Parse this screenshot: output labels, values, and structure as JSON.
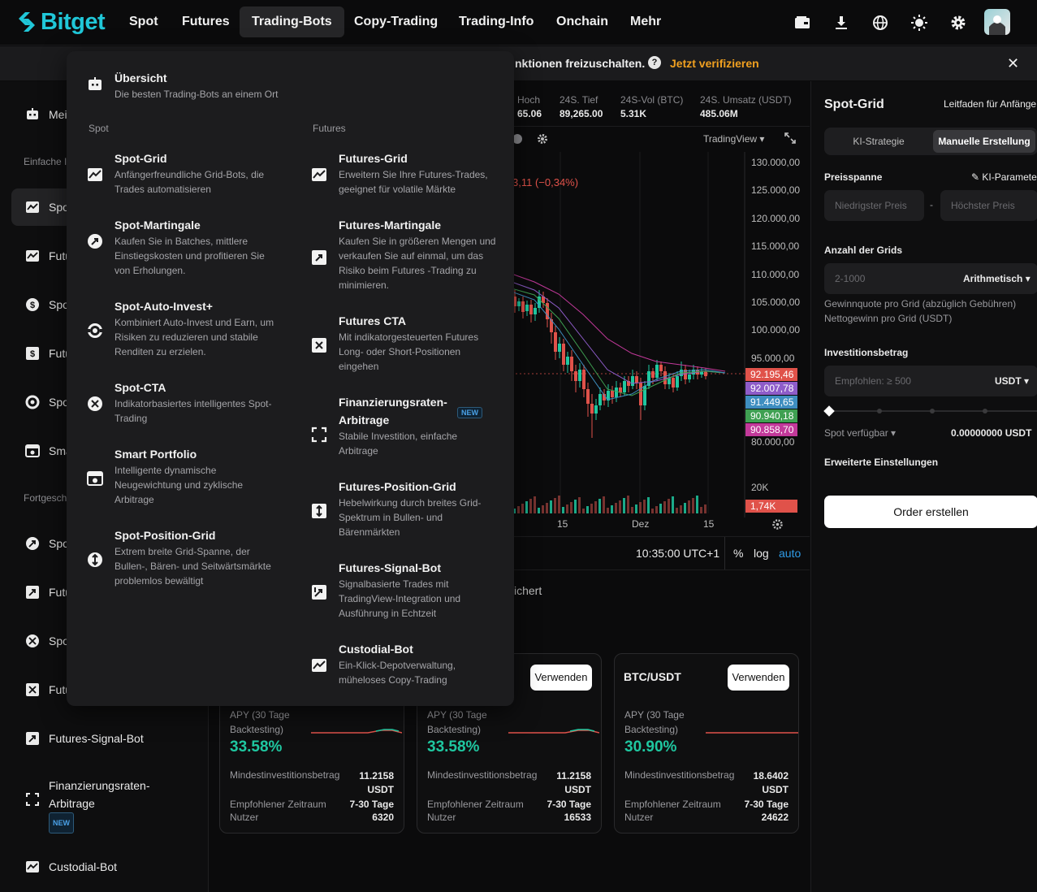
{
  "nav": {
    "logo": "Bitget",
    "items": [
      "Spot",
      "Futures",
      "Trading-Bots",
      "Copy-Trading",
      "Trading-Info",
      "Onchain",
      "Mehr"
    ]
  },
  "verify": {
    "text": "nktionen freizuschalten.",
    "link": "Jetzt verifizieren",
    "close": "✕"
  },
  "sidebar": {
    "items": [
      {
        "label": "Mei"
      },
      {
        "label": "Spo"
      },
      {
        "label": "Futu"
      },
      {
        "label": "Spo"
      },
      {
        "label": "Futu"
      },
      {
        "label": "Spo"
      },
      {
        "label": "Sma"
      },
      {
        "label": "Spo"
      },
      {
        "label": "Futu"
      },
      {
        "label": "Spo"
      },
      {
        "label": "Futu"
      },
      {
        "label": "Futures-Signal-Bot"
      },
      {
        "label": "Finanzierungsraten-"
      },
      {
        "label": "Arbitrage"
      },
      {
        "label": "Custodial-Bot"
      }
    ],
    "section_basic": "Einfache I",
    "section_advanced": "Fortgesch",
    "new_badge": "NEW"
  },
  "stats": {
    "high_label": "Hoch",
    "high_value": "65.06",
    "low_label": "24S. Tief",
    "low_value": "89,265.00",
    "vol_label": "24S-Vol (BTC)",
    "vol_value": "5.31K",
    "turnover_label": "24S. Umsatz (USDT)",
    "turnover_value": "485.06M"
  },
  "chart_toolbar": {
    "tradingview": "TradingView"
  },
  "chart": {
    "change_text": "3,11 (−0,34%)",
    "y_labels": [
      "130.000,00",
      "125.000,00",
      "120.000,00",
      "115.000,00",
      "110.000,00",
      "105.000,00",
      "100.000,00",
      "95.000,00",
      "80.000,00"
    ],
    "price_tags": [
      {
        "value": "92.195,46",
        "color": "#e0524a"
      },
      {
        "value": "92.007,78",
        "color": "#8e5cc9"
      },
      {
        "value": "91.449,65",
        "color": "#3e8ec0"
      },
      {
        "value": "90.940,18",
        "color": "#3fa052"
      },
      {
        "value": "90.858,70",
        "color": "#c2399a"
      }
    ],
    "vol_label": "20K",
    "vol_tag": "1,74K",
    "x_labels": [
      "15",
      "Dez",
      "15"
    ]
  },
  "time_row": {
    "time": "10:35:00 UTC+1",
    "pct": "%",
    "log": "log",
    "auto": "auto"
  },
  "saved_text": "ichert",
  "cards": [
    {
      "pair": "",
      "use": "",
      "apy_label": "APY (30 Tage Backtesting)",
      "apy": "33.58%",
      "min_label": "Mindestinvestitionsbetrag",
      "min_value": "11.2158 USDT",
      "period_label": "Empfohlener Zeitraum",
      "period_value": "7-30 Tage",
      "users_label": "Nutzer",
      "users_value": "6320"
    },
    {
      "pair": "",
      "use": "Verwenden",
      "apy_label": "APY (30 Tage Backtesting)",
      "apy": "33.58%",
      "min_label": "Mindestinvestitionsbetrag",
      "min_value": "11.2158 USDT",
      "period_label": "Empfohlener Zeitraum",
      "period_value": "7-30 Tage",
      "users_label": "Nutzer",
      "users_value": "16533"
    },
    {
      "pair": "BTC/USDT",
      "use": "Verwenden",
      "apy_label": "APY (30 Tage Backtesting)",
      "apy": "30.90%",
      "min_label": "Mindestinvestitionsbetrag",
      "min_value": "18.6402 USDT",
      "period_label": "Empfohlener Zeitraum",
      "period_value": "7-30 Tage",
      "users_label": "Nutzer",
      "users_value": "24622"
    }
  ],
  "right": {
    "title": "Spot-Grid",
    "guide": "Leitfaden für Anfänge",
    "tab_ai": "KI-Strategie",
    "tab_manual": "Manuelle Erstellung",
    "price_range": "Preisspanne",
    "ai_params": "KI-Paramete",
    "low_price_ph": "Niedrigster Preis",
    "high_price_ph": "Höchster Preis",
    "dash": "-",
    "grid_count": "Anzahl der Grids",
    "grid_ph": "2-1000",
    "grid_mode": "Arithmetisch",
    "profit_note": "Gewinnquote pro Grid (abzüglich Gebühren)",
    "net_note": "Nettogewinn pro Grid (USDT)",
    "invest_label": "Investitionsbetrag",
    "invest_ph": "Empfohlen: ≥ 500",
    "invest_unit": "USDT",
    "available_label": "Spot verfügbar",
    "available_value": "0.00000000 USDT",
    "advanced": "Erweiterte Einstellungen",
    "order_btn": "Order erstellen"
  },
  "dropdown": {
    "overview_title": "Übersicht",
    "overview_desc": "Die besten Trading-Bots an einem Ort",
    "spot_section": "Spot",
    "futures_section": "Futures",
    "spot_items": [
      {
        "title": "Spot-Grid",
        "desc": "Anfängerfreundliche Grid-Bots, die Trades automatisieren"
      },
      {
        "title": "Spot-Martingale",
        "desc": "Kaufen Sie in Batches, mittlere Einstiegskosten und profitieren Sie von Erholungen."
      },
      {
        "title": "Spot-Auto-Invest+",
        "desc": "Kombiniert Auto-Invest und Earn, um Risiken zu reduzieren und stabile Renditen zu erzielen."
      },
      {
        "title": "Spot-CTA",
        "desc": "Indikatorbasiertes intelligentes Spot-Trading"
      },
      {
        "title": "Smart Portfolio",
        "desc": "Intelligente dynamische Neugewichtung und zyklische Arbitrage"
      },
      {
        "title": "Spot-Position-Grid",
        "desc": "Extrem breite Grid-Spanne, der Bullen-, Bären- und Seitwärtsmärkte problemlos bewältigt"
      }
    ],
    "futures_items": [
      {
        "title": "Futures-Grid",
        "desc": "Erweitern Sie Ihre Futures-Trades, geeignet für volatile Märkte"
      },
      {
        "title": "Futures-Martingale",
        "desc": "Kaufen Sie in größeren Mengen und verkaufen Sie auf einmal, um das Risiko beim Futures -Trading zu minimieren."
      },
      {
        "title": "Futures CTA",
        "desc": "Mit indikatorgesteuerten Futures Long- oder Short-Positionen eingehen"
      },
      {
        "title": "Finanzierungsraten-Arbitrage",
        "desc": "Stabile Investition, einfache Arbitrage",
        "badge": "NEW"
      },
      {
        "title": "Futures-Position-Grid",
        "desc": "Hebelwirkung durch breites Grid-Spektrum in Bullen- und Bärenmärkten"
      },
      {
        "title": "Futures-Signal-Bot",
        "desc": "Signalbasierte Trades mit TradingView-Integration und Ausführung in Echtzeit"
      },
      {
        "title": "Custodial-Bot",
        "desc": "Ein-Klick-Depotverwaltung, müheloses Copy-Trading"
      }
    ]
  },
  "colors": {
    "brand": "#20c7d8",
    "accent_orange": "#f0a020",
    "green": "#1fc7a0",
    "red": "#e0524a"
  }
}
